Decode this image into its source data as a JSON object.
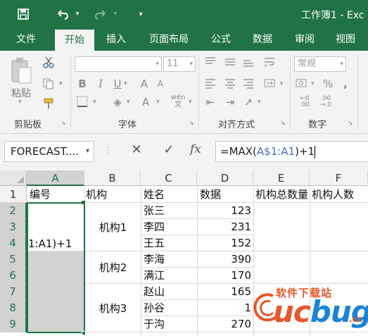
{
  "titlebar": {
    "title": "工作簿1 - Exc",
    "save_icon": "save-icon",
    "undo_icon": "undo-icon",
    "redo_icon": "redo-icon",
    "customize_icon": "customize-quick-access-icon"
  },
  "tabs": [
    "文件",
    "开始",
    "插入",
    "页面布局",
    "公式",
    "数据",
    "审阅",
    "视图"
  ],
  "active_tab": "开始",
  "ribbon": {
    "clipboard": {
      "paste_label": "粘贴",
      "group_label": "剪贴板"
    },
    "font": {
      "group_label": "字体",
      "font_name": "",
      "font_size": "11"
    },
    "alignment": {
      "group_label": "对齐方式"
    },
    "number": {
      "group_label": "数字",
      "format": "常规"
    },
    "format_buttons": [
      "B",
      "I",
      "U",
      "A",
      "A"
    ]
  },
  "formula_bar": {
    "name_box": "FORECAST....",
    "formula_prefix": "=MAX(",
    "formula_ref": "A$1:A1",
    "formula_suffix": ")+1"
  },
  "grid": {
    "columns": [
      "A",
      "B",
      "C",
      "D",
      "E",
      "F"
    ],
    "rows": [
      "1",
      "2",
      "3",
      "4",
      "5",
      "6",
      "7",
      "8",
      "9"
    ],
    "headers": {
      "A1": "编号",
      "B1": "机构",
      "C1": "姓名",
      "D1": "数据",
      "E1": "机构总数量",
      "F1": "机构人数"
    },
    "active_cell_text": "1:A1)+1",
    "org_groups": [
      "机构1",
      "机构2",
      "机构3"
    ],
    "names": [
      "张三",
      "李四",
      "王五",
      "李海",
      "满江",
      "赵山",
      "孙谷",
      "于沟"
    ],
    "values": [
      "123",
      "231",
      "152",
      "390",
      "170",
      "165",
      "1",
      "270"
    ]
  },
  "watermark": {
    "top_text": "软件下载站",
    "logo_left": "uc",
    "logo_right": "bug",
    "suffix": ".cc"
  },
  "colors": {
    "accent": "#217346",
    "ref_blue": "#4472c4",
    "selection": "#d3d3d3"
  }
}
